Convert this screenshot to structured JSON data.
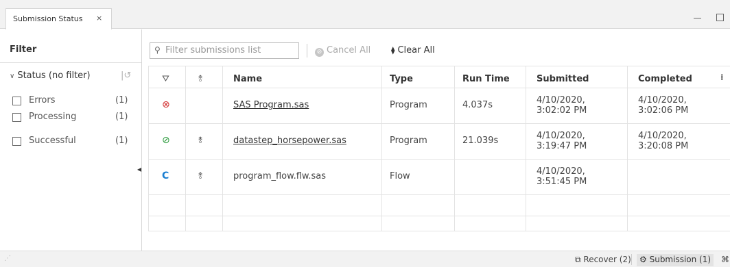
{
  "tab": {
    "title": "Submission Status",
    "close": "×"
  },
  "filter": {
    "title": "Filter",
    "group_label": "Status (no filter)",
    "options": [
      {
        "label": "Errors",
        "count": "(1)"
      },
      {
        "label": "Processing",
        "count": "(1)"
      },
      {
        "label": "Successful",
        "count": "(1)"
      }
    ]
  },
  "toolbar": {
    "search_placeholder": "Filter submissions list",
    "cancel_all": "Cancel All",
    "clear_all": "Clear All"
  },
  "table": {
    "columns": [
      "Name",
      "Type",
      "Run Time",
      "Submitted",
      "Completed"
    ],
    "rows": [
      {
        "status": "error",
        "name": "SAS Program.sas",
        "type": "Program",
        "run_time": "4.037s",
        "submitted_date": "4/10/2020,",
        "submitted_time": "3:02:02 PM",
        "completed_date": "4/10/2020,",
        "completed_time": "3:02:06 PM"
      },
      {
        "status": "success",
        "name": "datastep_horsepower.sas",
        "type": "Program",
        "run_time": "21.039s",
        "submitted_date": "4/10/2020,",
        "submitted_time": "3:19:47 PM",
        "completed_date": "4/10/2020,",
        "completed_time": "3:20:08 PM"
      },
      {
        "status": "running",
        "name": "program_flow.flw.sas",
        "type": "Flow",
        "run_time": "",
        "submitted_date": "4/10/2020,",
        "submitted_time": "3:51:45 PM",
        "completed_date": "",
        "completed_time": ""
      }
    ]
  },
  "statusbar": {
    "recover": "Recover (2)",
    "submission": "Submission (1)"
  },
  "icons": {
    "status_filter": "funnel-icon",
    "resubmit": "anchor-icon",
    "error": "error-circle-icon",
    "success": "check-circle-icon",
    "running": "spinner-icon"
  },
  "colors": {
    "error": "#d12d2d",
    "success": "#2c9b3d",
    "running": "#1b7fd1",
    "accent": "#4c5a70"
  }
}
